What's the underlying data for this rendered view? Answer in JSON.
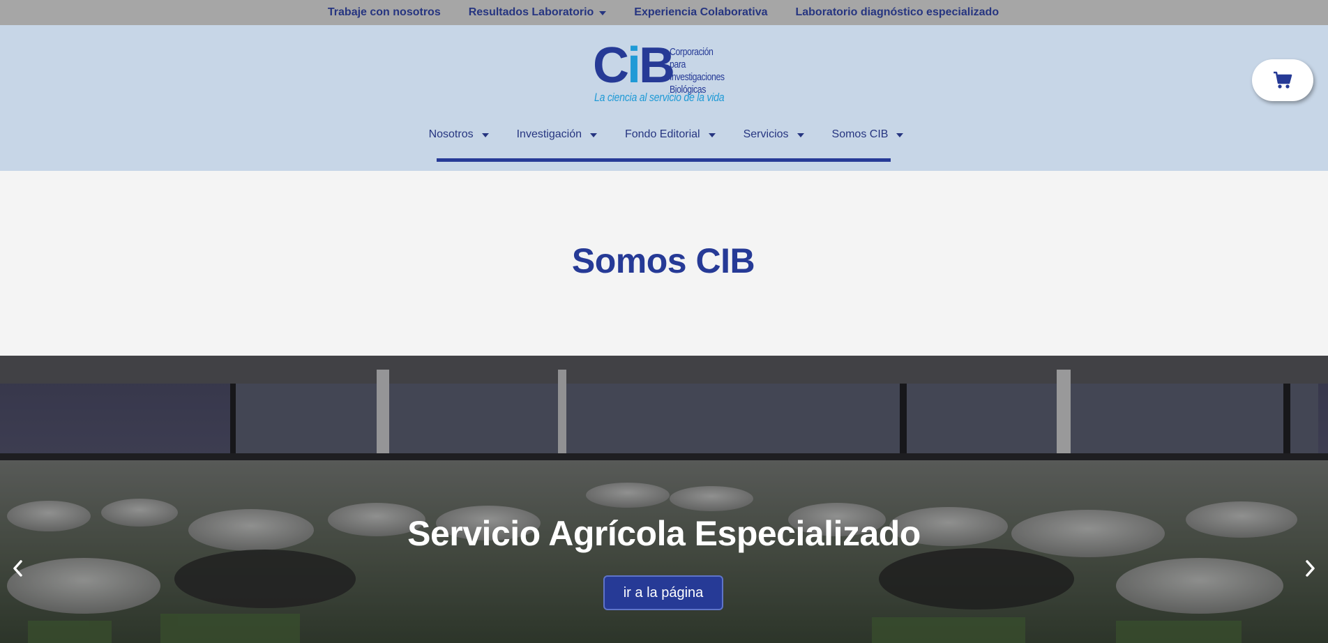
{
  "topbar": {
    "links": [
      {
        "label": "Trabaje con nosotros"
      },
      {
        "label": "Resultados Laboratorio"
      },
      {
        "label": "Experiencia Colaborativa"
      },
      {
        "label": "Laboratorio diagnóstico especializado"
      }
    ]
  },
  "logo": {
    "mark_c": "C",
    "mark_i": "i",
    "mark_b": "B",
    "org_line1": "Corporación para",
    "org_line2": "Investigaciones",
    "org_line3": "Biológicas",
    "tagline": "La ciencia al servicio de la vida"
  },
  "cart": {
    "icon": "shopping-cart-icon"
  },
  "nav": {
    "items": [
      {
        "label": "Nosotros"
      },
      {
        "label": "Investigación"
      },
      {
        "label": "Fondo Editorial"
      },
      {
        "label": "Servicios"
      },
      {
        "label": "Somos CIB"
      }
    ]
  },
  "page": {
    "title": "Somos CIB"
  },
  "hero": {
    "heading": "Servicio Agrícola Especializado",
    "button_label": "ir a la página",
    "prev_icon": "chevron-left-icon",
    "next_icon": "chevron-right-icon"
  },
  "colors": {
    "brand_blue": "#263a96",
    "topbar_bg": "#a6a6a6",
    "header_bg": "#c7d6e7",
    "accent_light_blue": "#1f9ad6"
  }
}
